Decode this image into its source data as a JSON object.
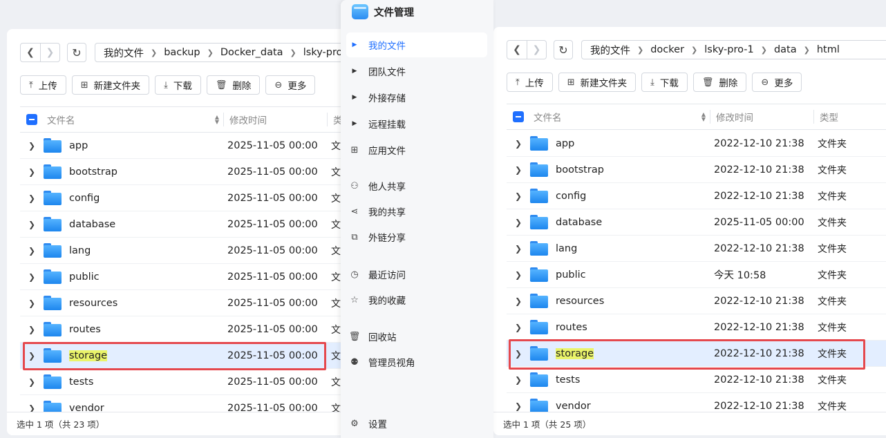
{
  "left_pane": {
    "breadcrumb": [
      "我的文件",
      "backup",
      "Docker_data",
      "lsky-pro"
    ],
    "toolbar": {
      "upload": "上传",
      "new_folder": "新建文件夹",
      "download": "下载",
      "delete": "删除",
      "more": "更多"
    },
    "columns": {
      "name": "文件名",
      "modified": "修改时间",
      "type": "类"
    },
    "rows": [
      {
        "name": "app",
        "time": "2025-11-05 00:00",
        "type": "文"
      },
      {
        "name": "bootstrap",
        "time": "2025-11-05 00:00",
        "type": "文"
      },
      {
        "name": "config",
        "time": "2025-11-05 00:00",
        "type": "文"
      },
      {
        "name": "database",
        "time": "2025-11-05 00:00",
        "type": "文"
      },
      {
        "name": "lang",
        "time": "2025-11-05 00:00",
        "type": "文"
      },
      {
        "name": "public",
        "time": "2025-11-05 00:00",
        "type": "文"
      },
      {
        "name": "resources",
        "time": "2025-11-05 00:00",
        "type": "文"
      },
      {
        "name": "routes",
        "time": "2025-11-05 00:00",
        "type": "文"
      },
      {
        "name": "storage",
        "time": "2025-11-05 00:00",
        "type": "文",
        "selected": true
      },
      {
        "name": "tests",
        "time": "2025-11-05 00:00",
        "type": "文"
      },
      {
        "name": "vendor",
        "time": "2025-11-05 00:00",
        "type": "文"
      }
    ],
    "status": "选中 1 项（共 23 项）"
  },
  "sidebar": {
    "title": "文件管理",
    "items": [
      {
        "label": "我的文件",
        "icon": "caret-right-icon",
        "active": true
      },
      {
        "label": "团队文件",
        "icon": "caret-right-icon"
      },
      {
        "label": "外接存储",
        "icon": "caret-right-icon"
      },
      {
        "label": "远程挂载",
        "icon": "caret-right-icon"
      },
      {
        "label": "应用文件",
        "icon": "grid-icon"
      },
      {
        "label": "他人共享",
        "icon": "users-icon"
      },
      {
        "label": "我的共享",
        "icon": "share-icon"
      },
      {
        "label": "外链分享",
        "icon": "external-link-icon"
      },
      {
        "label": "最近访问",
        "icon": "clock-icon"
      },
      {
        "label": "我的收藏",
        "icon": "star-icon"
      },
      {
        "label": "回收站",
        "icon": "trash-icon"
      },
      {
        "label": "管理员视角",
        "icon": "admin-icon"
      }
    ],
    "settings": "设置"
  },
  "right_pane": {
    "breadcrumb": [
      "我的文件",
      "docker",
      "lsky-pro-1",
      "data",
      "html"
    ],
    "toolbar": {
      "upload": "上传",
      "new_folder": "新建文件夹",
      "download": "下载",
      "delete": "删除",
      "more": "更多"
    },
    "columns": {
      "name": "文件名",
      "modified": "修改时间",
      "type": "类型"
    },
    "rows": [
      {
        "name": "app",
        "time": "2022-12-10 21:38",
        "type": "文件夹"
      },
      {
        "name": "bootstrap",
        "time": "2022-12-10 21:38",
        "type": "文件夹"
      },
      {
        "name": "config",
        "time": "2022-12-10 21:38",
        "type": "文件夹"
      },
      {
        "name": "database",
        "time": "2025-11-05 00:00",
        "type": "文件夹"
      },
      {
        "name": "lang",
        "time": "2022-12-10 21:38",
        "type": "文件夹"
      },
      {
        "name": "public",
        "time": "今天 10:58",
        "type": "文件夹"
      },
      {
        "name": "resources",
        "time": "2022-12-10 21:38",
        "type": "文件夹"
      },
      {
        "name": "routes",
        "time": "2022-12-10 21:38",
        "type": "文件夹"
      },
      {
        "name": "storage",
        "time": "2022-12-10 21:38",
        "type": "文件夹",
        "selected": true
      },
      {
        "name": "tests",
        "time": "2022-12-10 21:38",
        "type": "文件夹"
      },
      {
        "name": "vendor",
        "time": "2022-12-10 21:38",
        "type": "文件夹"
      }
    ],
    "status": "选中 1 项（共 25 项）"
  },
  "colors": {
    "accent": "#1f6fff",
    "highlight_box": "#e5484d",
    "selected_row": "#e3eeff",
    "search_highlight": "#eaf46a"
  }
}
